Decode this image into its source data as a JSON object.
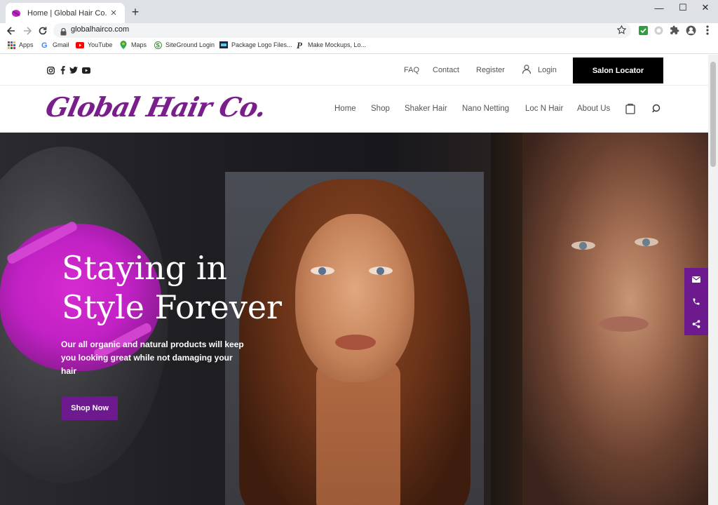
{
  "browser": {
    "tab_title": "Home | Global Hair Co.",
    "tab_close": "×",
    "new_tab": "+",
    "url": "globalhairco.com",
    "window_controls": {
      "minimize": "—",
      "maximize": "☐",
      "close": "✕"
    },
    "bookmarks": [
      {
        "label": "Apps",
        "icon": "apps-grid-icon"
      },
      {
        "label": "Gmail",
        "icon": "google-icon"
      },
      {
        "label": "YouTube",
        "icon": "youtube-icon"
      },
      {
        "label": "Maps",
        "icon": "maps-pin-icon"
      },
      {
        "label": "SiteGround Login",
        "icon": "siteground-icon"
      },
      {
        "label": "Package Logo Files...",
        "icon": "package-icon"
      },
      {
        "label": "Make Mockups, Lo...",
        "icon": "placeit-icon"
      }
    ]
  },
  "site": {
    "topbar": {
      "links": [
        "FAQ",
        "Contact",
        "Register",
        "Login"
      ],
      "salon_locator": "Salon Locator"
    },
    "logo": "Global Hair Co.",
    "nav": [
      "Home",
      "Shop",
      "Shaker Hair",
      "Nano Netting",
      "Loc N Hair",
      "About Us"
    ],
    "hero": {
      "title_line1": "Staying in",
      "title_line2": "Style Forever",
      "subtitle": "Our all organic and natural products will keep you looking great while not damaging your hair",
      "cta": "Shop Now"
    },
    "colors": {
      "brand": "#7a1e8c",
      "accent": "#6d1a8e",
      "splash": "#c121c4"
    }
  }
}
